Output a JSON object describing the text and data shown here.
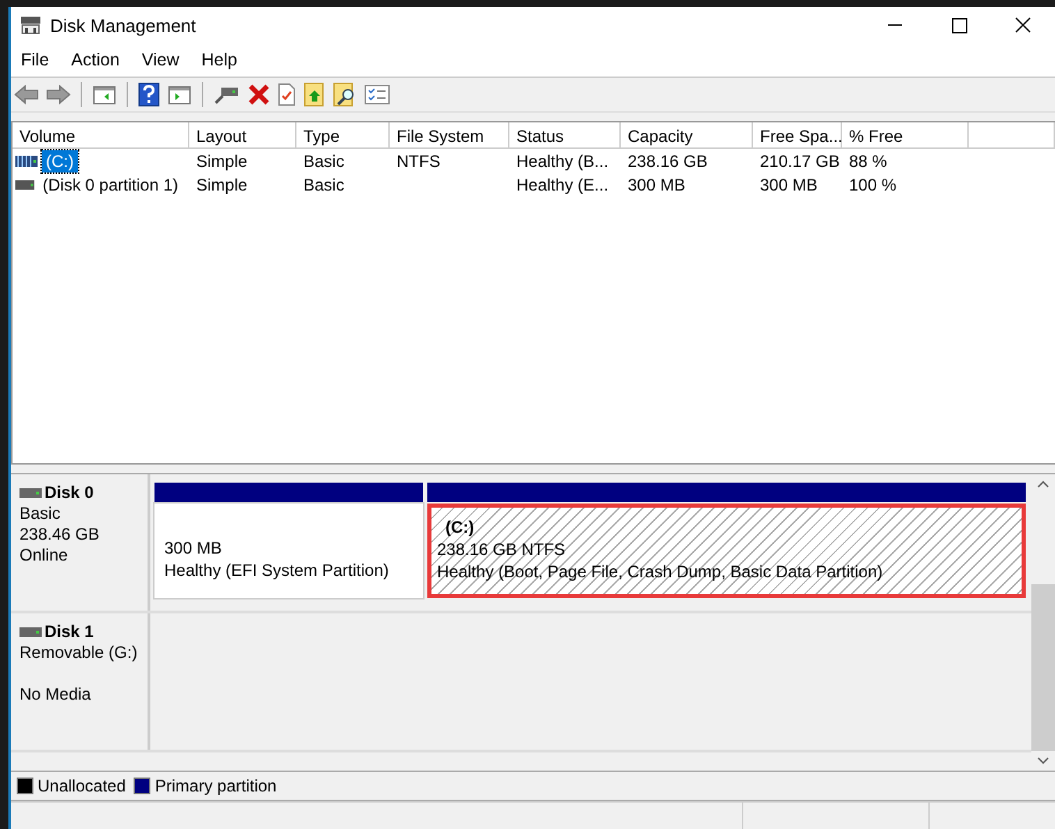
{
  "window": {
    "title": "Disk Management"
  },
  "menu": [
    "File",
    "Action",
    "View",
    "Help"
  ],
  "table": {
    "columns": [
      "Volume",
      "Layout",
      "Type",
      "File System",
      "Status",
      "Capacity",
      "Free Spa...",
      "% Free"
    ],
    "rows": [
      {
        "selected": true,
        "cells": [
          "(C:)",
          "Simple",
          "Basic",
          "NTFS",
          "Healthy (B...",
          "238.16 GB",
          "210.17 GB",
          "88 %"
        ]
      },
      {
        "selected": false,
        "cells": [
          "(Disk 0 partition 1)",
          "Simple",
          "Basic",
          "",
          "Healthy (E...",
          "300 MB",
          "300 MB",
          "100 %"
        ]
      }
    ]
  },
  "disks": [
    {
      "name": "Disk 0",
      "type": "Basic",
      "size": "238.46 GB",
      "status": "Online",
      "partitions": [
        {
          "kind": "primary",
          "selected": false,
          "highlighted": false,
          "size_line": "300 MB",
          "health": "Healthy (EFI System Partition)"
        },
        {
          "kind": "primary",
          "selected": true,
          "highlighted": true,
          "title": "(C:)",
          "size_line": "238.16 GB NTFS",
          "health": "Healthy (Boot, Page File, Crash Dump, Basic Data Partition)"
        }
      ]
    },
    {
      "name": "Disk 1",
      "type": "Removable (G:)",
      "status": "No Media"
    }
  ],
  "legend": [
    {
      "label": "Unallocated",
      "color": "#000000"
    },
    {
      "label": "Primary partition",
      "color": "#000080"
    }
  ]
}
